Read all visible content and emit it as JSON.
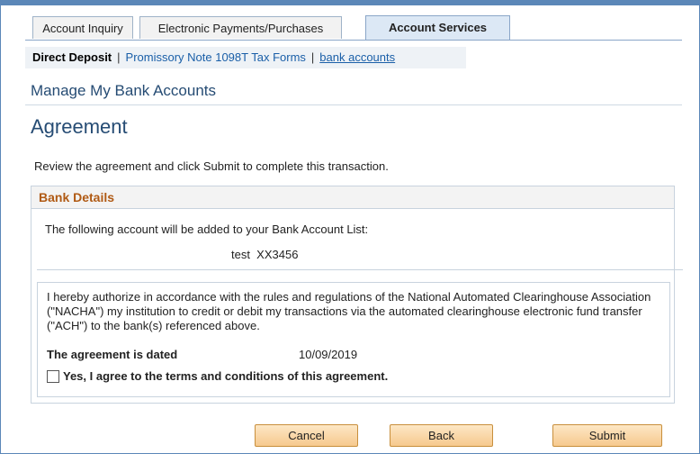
{
  "tabs": [
    {
      "label": "Account Inquiry"
    },
    {
      "label": "Electronic Payments/Purchases"
    },
    {
      "label": "Account Services"
    }
  ],
  "subnav": {
    "current": "Direct Deposit",
    "link1": "Promissory Note 1098T Tax Forms",
    "link2": "bank accounts",
    "sep": "|"
  },
  "page_header": "Manage My Bank Accounts",
  "title": "Agreement",
  "instruction": "Review the agreement and click Submit to complete this transaction.",
  "bank_details": {
    "header": "Bank Details",
    "added_text": "The following account will be added to your Bank Account List:",
    "account": "test  XX3456"
  },
  "agreement": {
    "legal_text": "I hereby authorize in accordance with the rules and regulations of the National Automated Clearinghouse Association (\"NACHA\") my institution to credit or debit my transactions via the automated clearinghouse electronic fund transfer (\"ACH\") to the bank(s) referenced above.",
    "date_label": "The agreement is dated",
    "date_value": "10/09/2019",
    "checkbox_label": "Yes, I agree to the terms and conditions of this agreement.",
    "checked": false
  },
  "buttons": {
    "cancel": "Cancel",
    "back": "Back",
    "submit": "Submit"
  }
}
